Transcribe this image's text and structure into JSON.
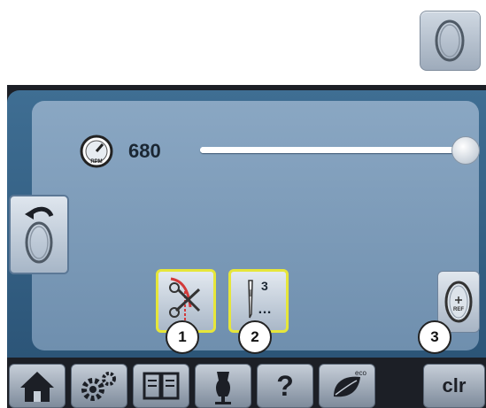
{
  "hoop_icon": "oval-hoop-icon",
  "speed": {
    "icon": "speedometer-rpm-icon",
    "value": "680",
    "level": 1.0
  },
  "buttons": {
    "back": "hoop-back-icon",
    "thread_cutter": "scissors-thread-cut-icon",
    "needle_stop": "needle-stop-icon",
    "needle_stop_number": "3",
    "needle_stop_dots": "…",
    "reference": "hoop-reference-icon"
  },
  "callouts": [
    "1",
    "2",
    "3"
  ],
  "toolbar": {
    "home": "home-icon",
    "settings": "settings-gears-icon",
    "tutorial": "tutorial-book-icon",
    "consultant": "dress-form-icon",
    "help": "?",
    "eco": "eco-leaf-icon",
    "clr": "clr"
  },
  "colors": {
    "panel": "#6f8fae",
    "highlight": "#e6e63a",
    "screen_bg": "#1c1f26"
  }
}
